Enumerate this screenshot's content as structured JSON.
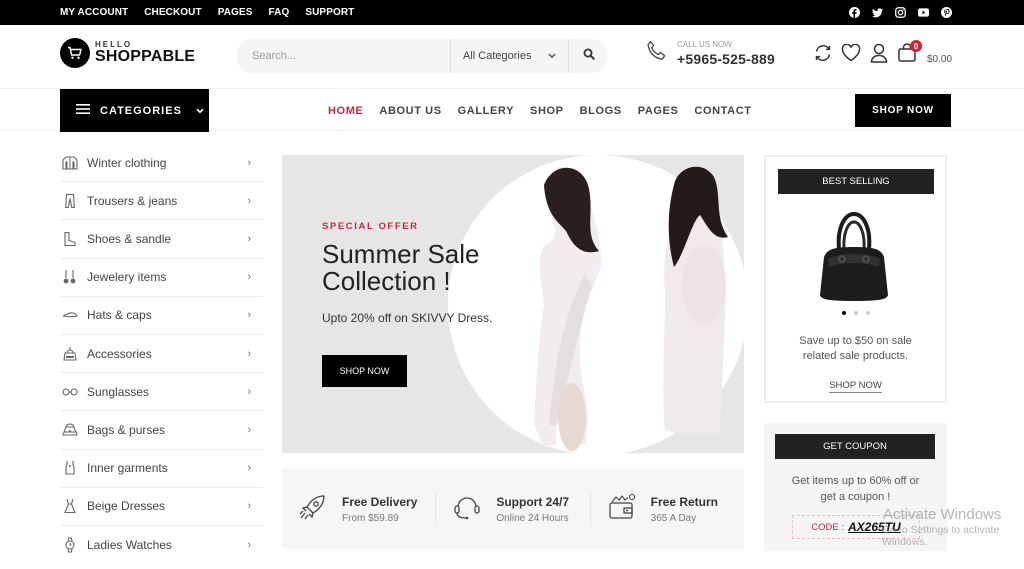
{
  "topbar": {
    "links": [
      "MY ACCOUNT",
      "CHECKOUT",
      "PAGES",
      "FAQ",
      "SUPPORT"
    ],
    "social": [
      "facebook-icon",
      "twitter-icon",
      "instagram-icon",
      "youtube-icon",
      "pinterest-icon"
    ]
  },
  "header": {
    "logo": {
      "small": "HELLO",
      "brand": "SHOPPABLE"
    },
    "search": {
      "placeholder": "Search...",
      "value": "",
      "category": "All Categories"
    },
    "call": {
      "label": "CALL US NOW",
      "number": "+5965-525-889"
    },
    "cart": {
      "count": "0",
      "total": "$0.00"
    }
  },
  "nav": {
    "categories_label": "CATEGORIES",
    "items": [
      "HOME",
      "ABOUT US",
      "GALLERY",
      "SHOP",
      "BLOGS",
      "PAGES",
      "CONTACT"
    ],
    "active": "HOME",
    "shop_now": "SHOP NOW"
  },
  "sidebar": {
    "items": [
      {
        "label": "Winter clothing",
        "icon": "jacket-icon"
      },
      {
        "label": "Trousers & jeans",
        "icon": "trousers-icon"
      },
      {
        "label": "Shoes & sandle",
        "icon": "boot-icon"
      },
      {
        "label": "Jewelery items",
        "icon": "earrings-icon"
      },
      {
        "label": "Hats & caps",
        "icon": "cap-icon"
      },
      {
        "label": "Accessories",
        "icon": "accessories-icon"
      },
      {
        "label": "Sunglasses",
        "icon": "sunglasses-icon"
      },
      {
        "label": "Bags & purses",
        "icon": "bag-icon"
      },
      {
        "label": "Inner garments",
        "icon": "inner-garment-icon"
      },
      {
        "label": "Beige Dresses",
        "icon": "dress-icon"
      },
      {
        "label": "Ladies Watches",
        "icon": "watch-icon"
      }
    ]
  },
  "hero": {
    "kicker": "SPECIAL OFFER",
    "title_line1": "Summer Sale",
    "title_line2": "Collection !",
    "subtitle": "Upto 20% off on SKIVVY Dress.",
    "cta": "SHOP NOW"
  },
  "features": [
    {
      "title": "Free Delivery",
      "sub": "From $59.89",
      "icon": "rocket-icon"
    },
    {
      "title": "Support 24/7",
      "sub": "Online 24 Hours",
      "icon": "headset-icon"
    },
    {
      "title": "Free Return",
      "sub": "365 A Day",
      "icon": "wallet-icon"
    }
  ],
  "best_selling": {
    "header": "BEST SELLING",
    "text_line1": "Save up to $50 on sale",
    "text_line2": "related sale products.",
    "link": "SHOP NOW",
    "slides": 3,
    "active_slide": 1
  },
  "coupon": {
    "header": "GET COUPON",
    "text_line1": "Get items up to 60% off or",
    "text_line2": "get a coupon !",
    "code_label": "CODE :",
    "code": "AX265TU"
  },
  "watermark": {
    "line1": "Activate Windows",
    "line2": "Go to Settings to activate Windows."
  },
  "colors": {
    "accent": "#c8283f",
    "dark": "#000000",
    "panel": "#222222",
    "hero_bg": "#e6e6e6",
    "features_bg": "#f4f6f8"
  }
}
